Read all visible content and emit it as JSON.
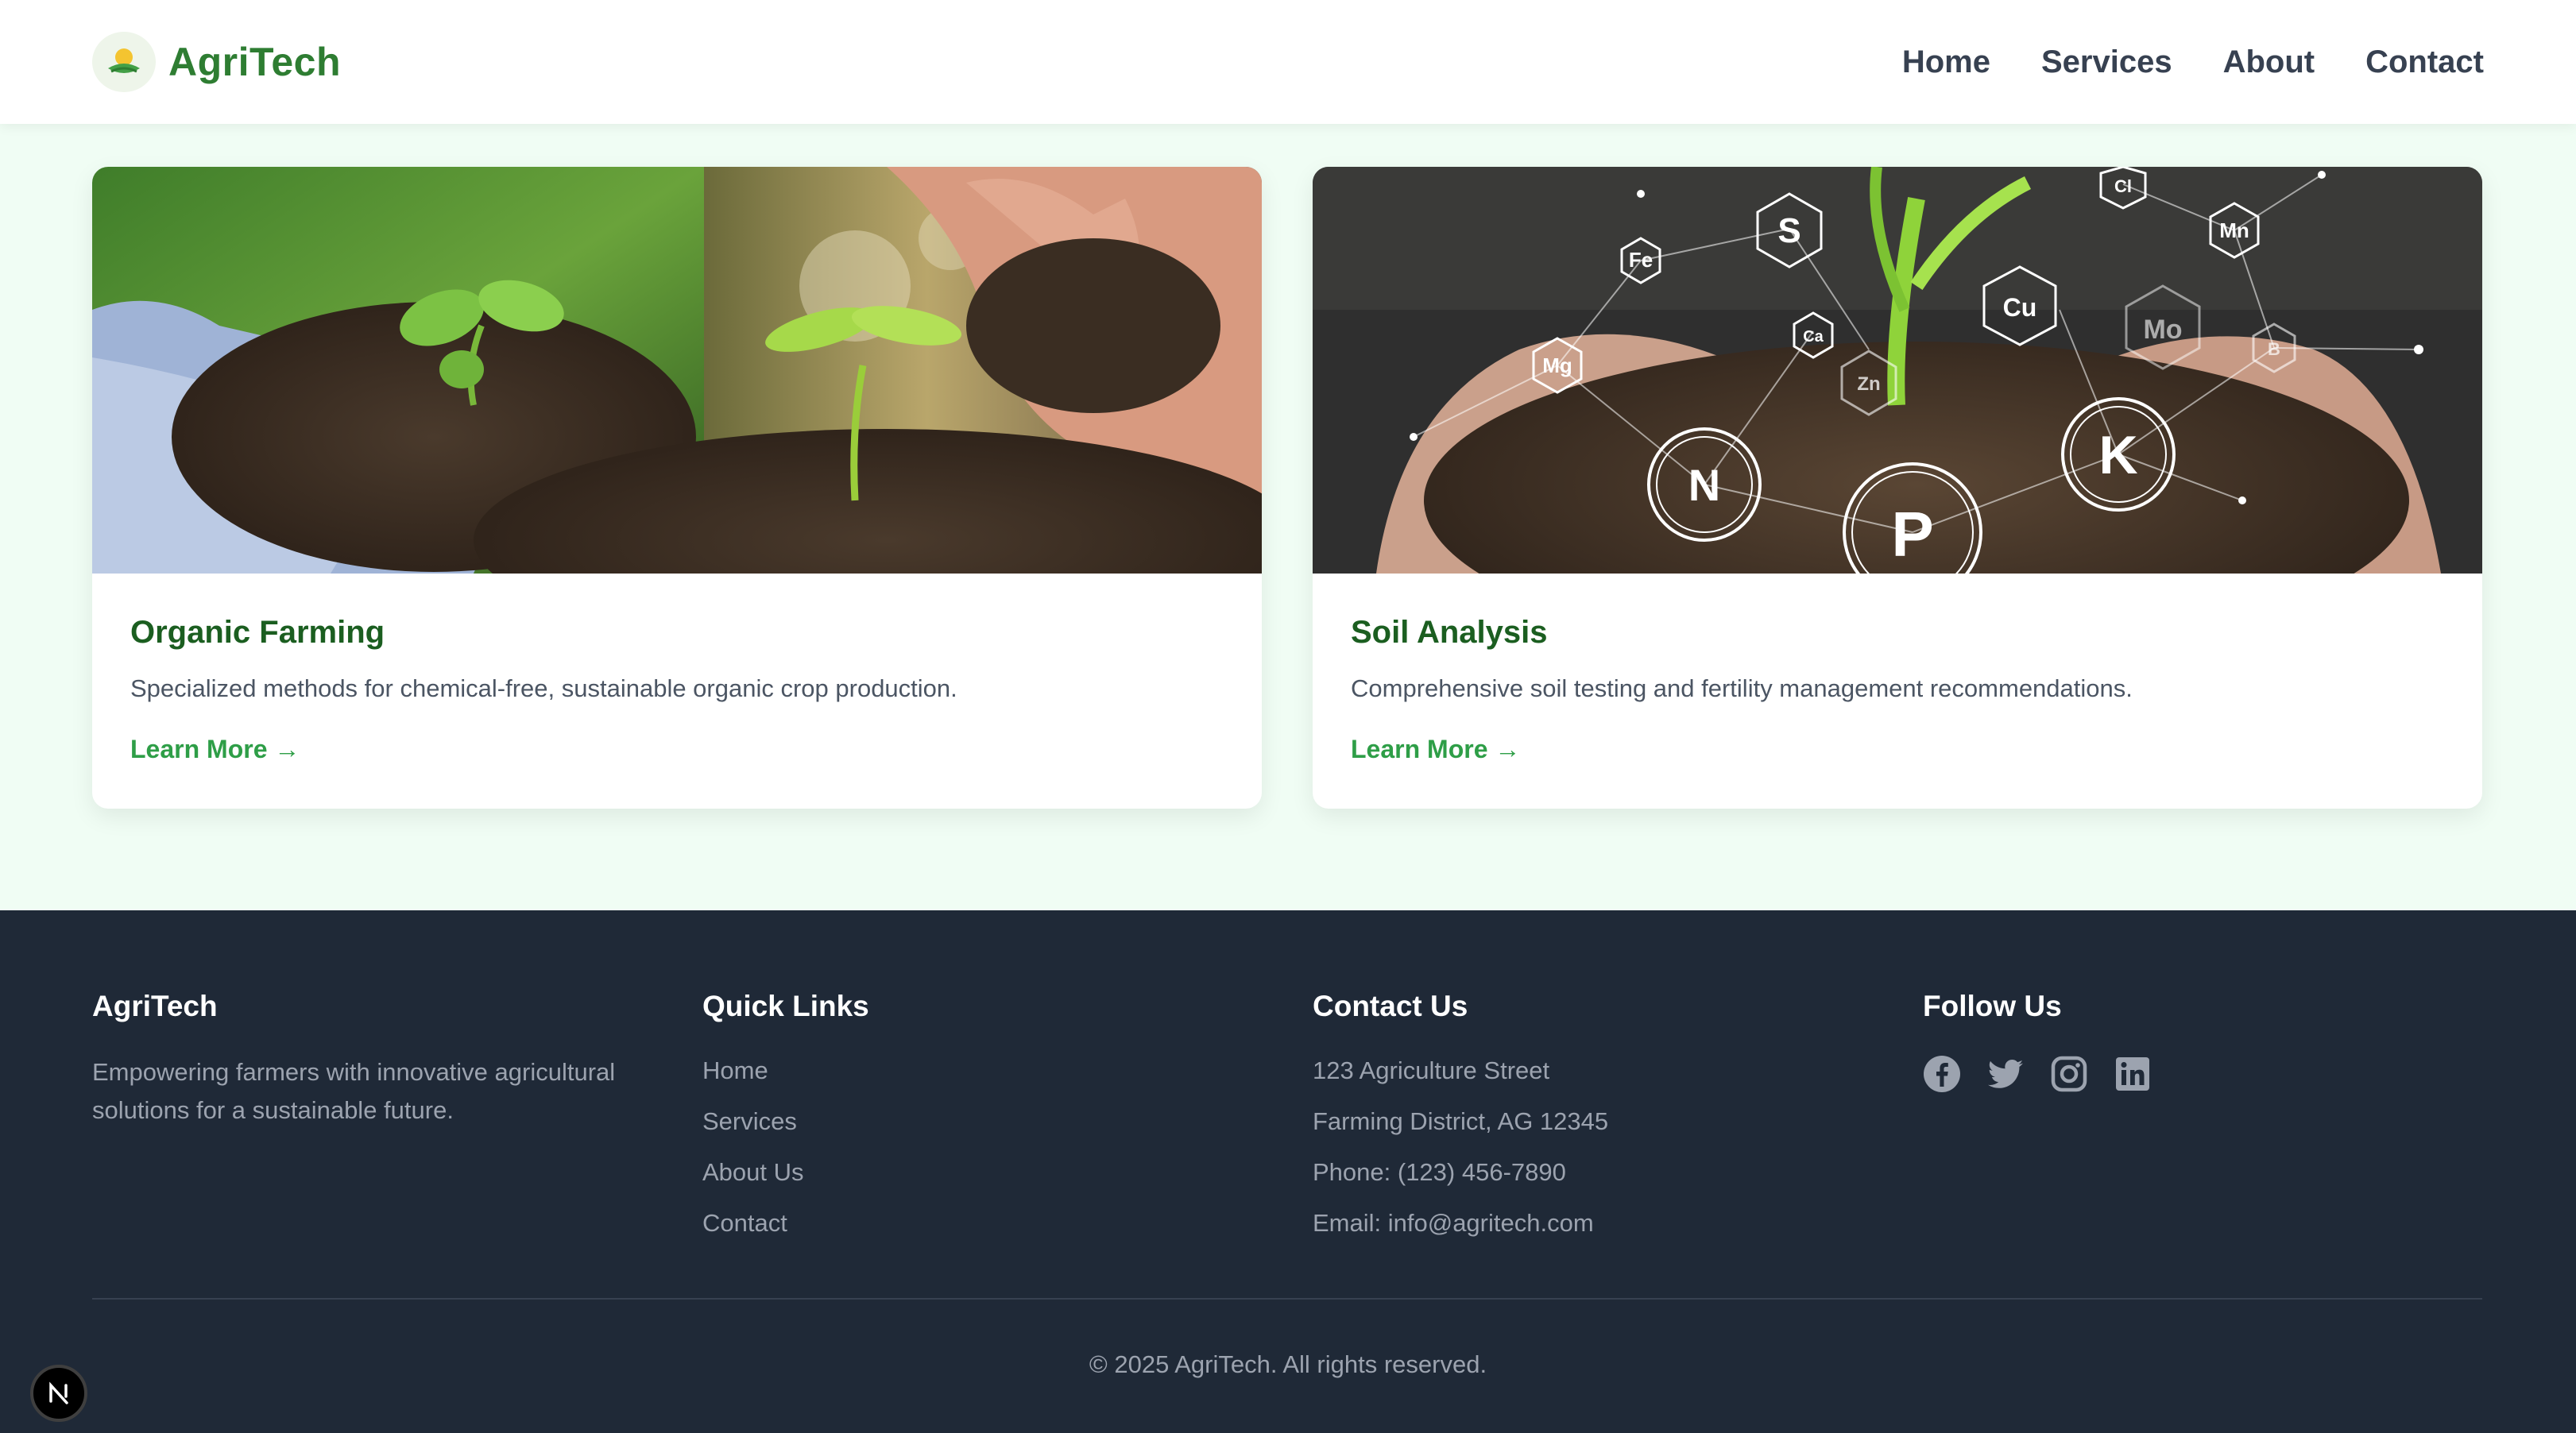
{
  "brand": {
    "name": "AgriTech"
  },
  "nav": [
    {
      "label": "Home"
    },
    {
      "label": "Services"
    },
    {
      "label": "About"
    },
    {
      "label": "Contact"
    }
  ],
  "cards": [
    {
      "title": "Organic Farming",
      "description": "Specialized methods for chemical-free, sustainable organic crop production.",
      "link": "Learn More →"
    },
    {
      "title": "Soil Analysis",
      "description": "Comprehensive soil testing and fertility management recommendations.",
      "link": "Learn More →",
      "image_labels": [
        "S",
        "Fe",
        "Cl",
        "Mn",
        "Cu",
        "Ca",
        "Mg",
        "Zn",
        "Mo",
        "B",
        "N",
        "P",
        "K"
      ]
    }
  ],
  "footer": {
    "about": {
      "title": "AgriTech",
      "text": "Empowering farmers with innovative agricultural solutions for a sustainable future."
    },
    "quick_links": {
      "title": "Quick Links",
      "items": [
        "Home",
        "Services",
        "About Us",
        "Contact"
      ]
    },
    "contact": {
      "title": "Contact Us",
      "items": [
        "123 Agriculture Street",
        "Farming District, AG 12345",
        "Phone: (123) 456-7890",
        "Email: info@agritech.com"
      ]
    },
    "follow": {
      "title": "Follow Us",
      "icons": [
        "facebook-icon",
        "twitter-icon",
        "instagram-icon",
        "linkedin-icon"
      ]
    },
    "copyright": "© 2025 AgriTech. All rights reserved."
  },
  "colors": {
    "brand_green": "#2e7d32",
    "link_green": "#2e9e47",
    "footer_bg": "#1f2937",
    "page_bg": "#f0fdf4"
  }
}
